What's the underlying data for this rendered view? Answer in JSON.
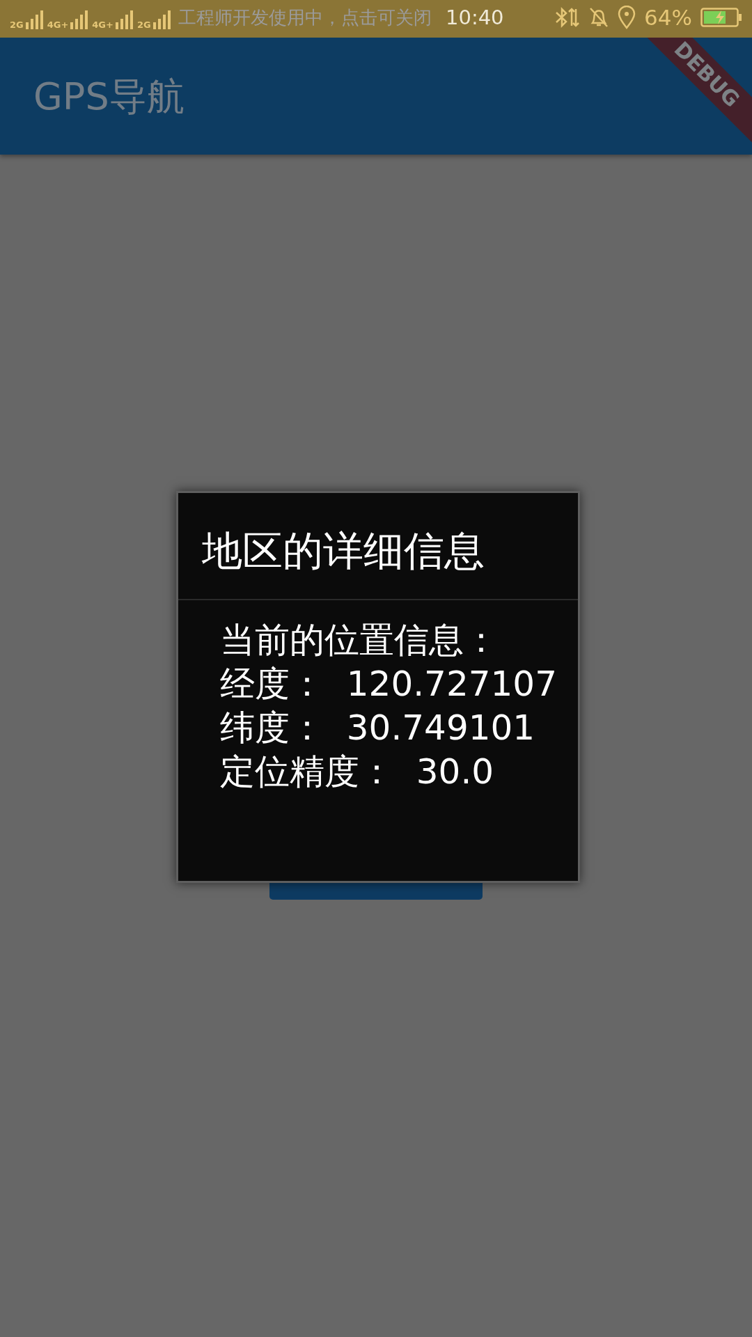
{
  "status_bar": {
    "network_labels": [
      "2G",
      "4G+",
      "4G+",
      "2G"
    ],
    "notification": "工程师开发使用中，点击可关闭",
    "time": "10:40",
    "battery_percent": "64%",
    "charging": true
  },
  "debug_banner": "DEBUG",
  "app_bar": {
    "title": "GPS导航"
  },
  "dialog": {
    "title": "地区的详细信息",
    "lines": [
      "当前的位置信息：",
      "经度：  120.727107",
      "纬度：  30.749101",
      "定位精度：  30.0"
    ]
  }
}
